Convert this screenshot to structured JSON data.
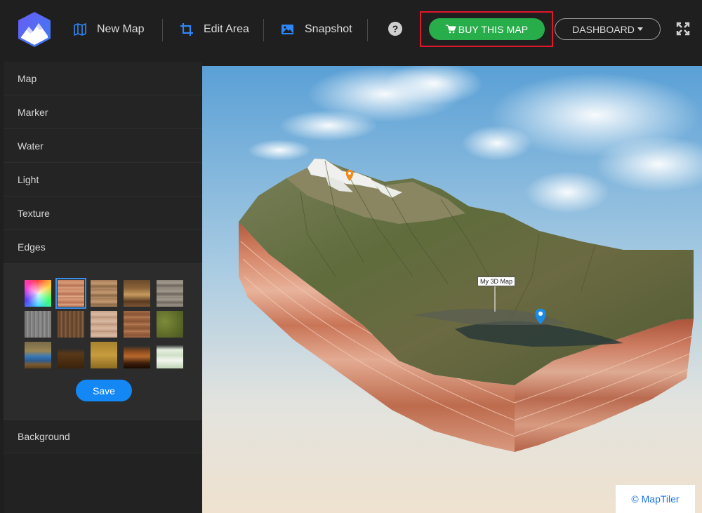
{
  "header": {
    "nav": [
      {
        "label": "New Map",
        "icon": "map-icon"
      },
      {
        "label": "Edit Area",
        "icon": "crop-icon"
      },
      {
        "label": "Snapshot",
        "icon": "image-icon"
      }
    ],
    "help_icon": "question-circle-icon",
    "buy_label": "BUY THIS MAP",
    "dashboard_label": "DASHBOARD",
    "fullscreen_icon": "expand-icon",
    "accent_color": "#27ae4a",
    "highlight_color": "#e0162b"
  },
  "sidebar": {
    "items": [
      {
        "label": "Map"
      },
      {
        "label": "Marker"
      },
      {
        "label": "Water"
      },
      {
        "label": "Light"
      },
      {
        "label": "Texture"
      },
      {
        "label": "Edges"
      }
    ],
    "after_items": [
      {
        "label": "Background"
      }
    ],
    "edges_panel": {
      "swatches": [
        "rainbow",
        "clay-layered",
        "sand-layered",
        "earth-dark",
        "stone-gray",
        "granite-gray",
        "bark-brown",
        "sandstone-light",
        "rust-layered",
        "moss-green",
        "ocean-layered",
        "dark-soil",
        "ochre",
        "lava-layered",
        "pale-green"
      ],
      "selected_index": 1,
      "save_label": "Save"
    }
  },
  "map": {
    "marker_label": "My 3D Map",
    "attribution": "© MapTiler"
  }
}
